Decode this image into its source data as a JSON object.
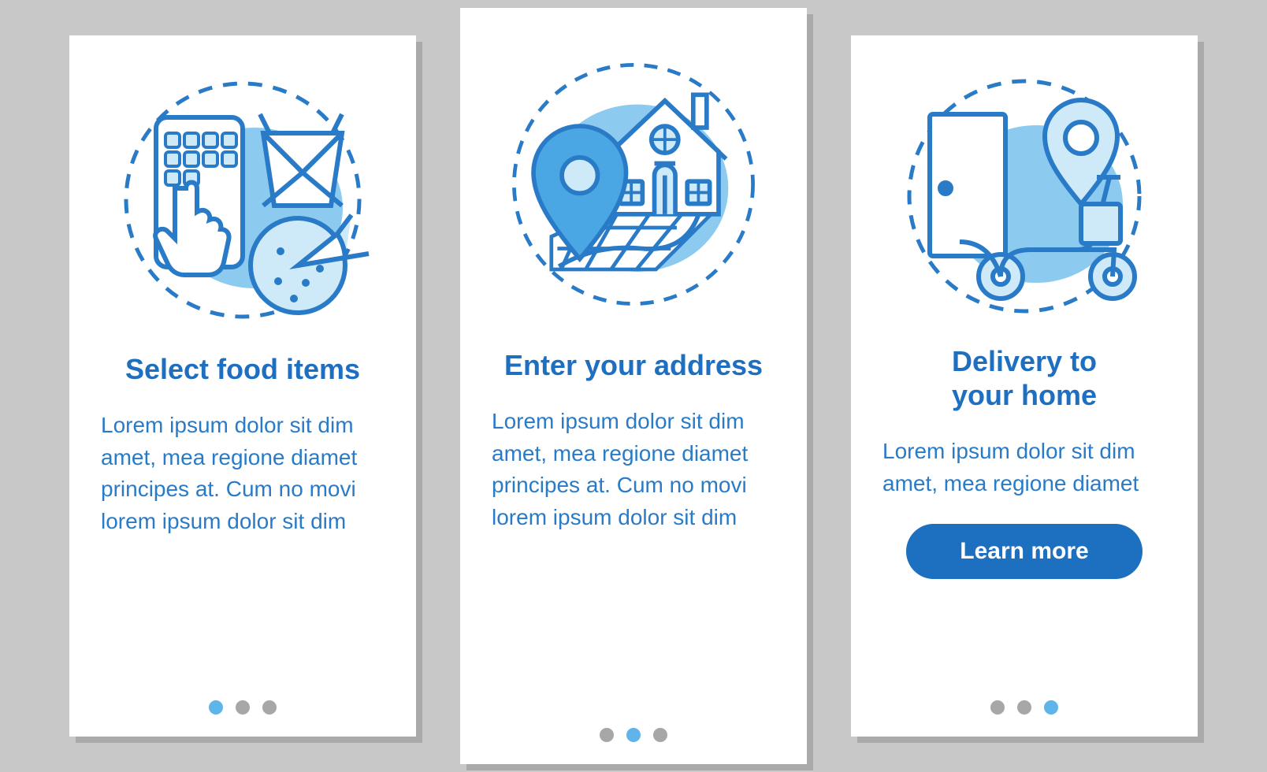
{
  "colors": {
    "accent": "#1d6fbf",
    "light": "#8dcaf0",
    "pale": "#cee9f8",
    "ink": "#2a7bc7"
  },
  "cards": [
    {
      "id": "select-food",
      "title": "Select food items",
      "desc": "Lorem ipsum dolor sit dim amet, mea regione diamet principes at. Cum no movi lorem ipsum dolor sit dim",
      "dots_active_index": 0,
      "has_button": false
    },
    {
      "id": "enter-address",
      "title": "Enter your address",
      "desc": "Lorem ipsum dolor sit dim amet, mea regione diamet principes at. Cum no movi lorem ipsum dolor sit dim",
      "dots_active_index": 1,
      "has_button": false
    },
    {
      "id": "delivery-home",
      "title": "Delivery to\nyour home",
      "desc": "Lorem ipsum dolor sit dim amet, mea regione diamet",
      "dots_active_index": 2,
      "has_button": true,
      "button_label": "Learn more"
    }
  ]
}
